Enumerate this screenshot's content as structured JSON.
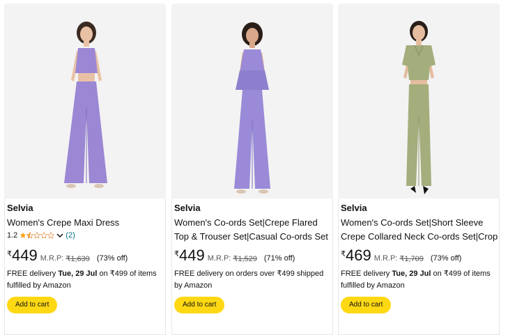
{
  "products": [
    {
      "brand": "Selvia",
      "title_line1": "Women's Crepe Maxi Dress",
      "rating": "1.2",
      "rating_count": "(2)",
      "rupee": "₹",
      "price": "449",
      "mrp_label": "M.R.P:",
      "mrp": "₹1,639",
      "discount": "(73% off)",
      "delivery_prefix": "FREE delivery ",
      "delivery_date": "Tue, 29 Jul",
      "delivery_suffix": " on ₹499 of items fulfilled by Amazon",
      "button": "Add to cart",
      "outfit_color": "#9b87d4"
    },
    {
      "brand": "Selvia",
      "title_line1": "Women's Co-ords Set|Crepe Flared",
      "title_line2": "Top & Trouser Set|Casual Co-ords Set",
      "rupee": "₹",
      "price": "449",
      "mrp_label": "M.R.P:",
      "mrp": "₹1,529",
      "discount": "(71% off)",
      "delivery_text": "FREE delivery on orders over ₹499 shipped by Amazon",
      "button": "Add to cart",
      "outfit_color": "#9a8ad8"
    },
    {
      "brand": "Selvia",
      "title_line1": "Women's Co-ords Set|Short Sleeve",
      "title_line2": "Crepe Collared Neck Co-ords Set|Crop",
      "rupee": "₹",
      "price": "469",
      "mrp_label": "M.R.P:",
      "mrp": "₹1,709",
      "discount": "(73% off)",
      "delivery_prefix": "FREE delivery ",
      "delivery_date": "Tue, 29 Jul",
      "delivery_suffix": " on ₹499 of items fulfilled by Amazon",
      "button": "Add to cart",
      "outfit_color": "#a4ad7c"
    }
  ],
  "colors": {
    "star": "#ffa41c",
    "button_bg": "#ffd814",
    "link": "#007185"
  }
}
